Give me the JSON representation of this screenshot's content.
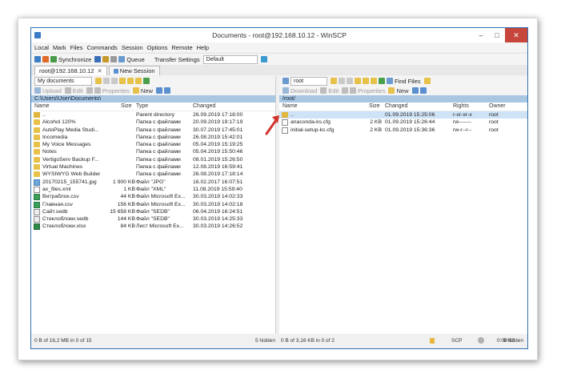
{
  "window": {
    "title": "Documents - root@192.168.10.12 - WinSCP"
  },
  "menu": [
    "Local",
    "Mark",
    "Files",
    "Commands",
    "Session",
    "Options",
    "Remote",
    "Help"
  ],
  "toolbar": {
    "synchronize": "Synchronize",
    "queue": "Queue",
    "transfer_settings_label": "Transfer Settings",
    "transfer_settings_value": "Default"
  },
  "tabs": [
    {
      "label": "root@192.168.10.12",
      "close": "✕"
    },
    {
      "label": "New Session"
    }
  ],
  "left": {
    "location": "My documents",
    "actions": {
      "upload": "Upload",
      "edit": "Edit",
      "properties": "Properties",
      "new": "New"
    },
    "path": "C:\\Users\\User\\Documents\\",
    "columns": {
      "name": "Name",
      "size": "Size",
      "type": "Type",
      "changed": "Changed"
    },
    "rows": [
      {
        "name": "..",
        "size": "",
        "type": "Parent directory",
        "changed": "26.09.2019 17:18:00",
        "kind": "up"
      },
      {
        "name": "Alcohol 120%",
        "size": "",
        "type": "Папка с файлами",
        "changed": "20.09.2019 19:17:19",
        "kind": "folder"
      },
      {
        "name": "AutoPlay Media Studi...",
        "size": "",
        "type": "Папка с файлами",
        "changed": "30.07.2019 17:45:01",
        "kind": "folder"
      },
      {
        "name": "Incomedia",
        "size": "",
        "type": "Папка с файлами",
        "changed": "26.08.2019 15:42:01",
        "kind": "folder"
      },
      {
        "name": "My Voice Messages",
        "size": "",
        "type": "Папка с файлами",
        "changed": "05.04.2019 15:19:25",
        "kind": "folder"
      },
      {
        "name": "Notes",
        "size": "",
        "type": "Папка с файлами",
        "changed": "05.04.2019 15:50:46",
        "kind": "folder"
      },
      {
        "name": "VertigoServ Backup F...",
        "size": "",
        "type": "Папка с файлами",
        "changed": "08.01.2019 15:26:50",
        "kind": "folder"
      },
      {
        "name": "Virtual Machines",
        "size": "",
        "type": "Папка с файлами",
        "changed": "12.08.2019 16:59:41",
        "kind": "folder"
      },
      {
        "name": "WYSIWYG Web Builder",
        "size": "",
        "type": "Папка с файлами",
        "changed": "26.08.2019 17:18:14",
        "kind": "folder"
      },
      {
        "name": "20170215_155741.jpg",
        "size": "1 900 KB",
        "type": "Файл \"JPG\"",
        "changed": "16.02.2017 16:07:51",
        "kind": "img"
      },
      {
        "name": "ax_files.xml",
        "size": "1 KB",
        "type": "Файл \"XML\"",
        "changed": "11.08.2019 15:59:40",
        "kind": "file"
      },
      {
        "name": "Витраблок.csv",
        "size": "44 KB",
        "type": "Файл Microsoft Ex...",
        "changed": "30.03.2019 14:02:33",
        "kind": "csv"
      },
      {
        "name": "Главная.csv",
        "size": "156 KB",
        "type": "Файл Microsoft Ex...",
        "changed": "30.03.2019 14:02:18",
        "kind": "csv"
      },
      {
        "name": "Сайт.sedb",
        "size": "15 658 KB",
        "type": "Файл \"SEDB\"",
        "changed": "06.04.2019 16:24:51",
        "kind": "sdb"
      },
      {
        "name": "Стеклоблоки.sedb",
        "size": "144 KB",
        "type": "Файл \"SEDB\"",
        "changed": "30.03.2019 14:25:33",
        "kind": "sdb"
      },
      {
        "name": "Стеклоблоки.xlsx",
        "size": "84 KB",
        "type": "Лист Microsoft Ex...",
        "changed": "30.03.2019 14:26:52",
        "kind": "xls"
      }
    ],
    "status_left": "0 B of 16,2 MB in 0 of 15",
    "status_hidden": "5 hidden"
  },
  "right": {
    "location": "root",
    "find_files": "Find Files",
    "actions": {
      "download": "Download",
      "edit": "Edit",
      "properties": "Properties",
      "new": "New"
    },
    "path": "/root/",
    "columns": {
      "name": "Name",
      "size": "Size",
      "changed": "Changed",
      "rights": "Rights",
      "owner": "Owner"
    },
    "rows": [
      {
        "name": "..",
        "size": "",
        "changed": "01.09.2019 15:25:06",
        "rights": "r-xr-xr-x",
        "owner": "root",
        "kind": "up",
        "selected": true
      },
      {
        "name": "anaconda-ks.cfg",
        "size": "2 KB",
        "changed": "01.09.2019 15:26:44",
        "rights": "rw-------",
        "owner": "root",
        "kind": "file"
      },
      {
        "name": "initial-setup-ks.cfg",
        "size": "2 KB",
        "changed": "01.09.2019 15:36:36",
        "rights": "rw-r--r--",
        "owner": "root",
        "kind": "file"
      }
    ],
    "status_left": "0 B of 3,16 KB in 0 of 2",
    "status_hidden": "9 hidden"
  },
  "status": {
    "protocol": "SCP",
    "timer": "0:00:02"
  },
  "colors": {
    "path_bar": "#a9c6e3",
    "selection": "#cfe3f7",
    "arrow": "#d0332a",
    "close": "#c7463b"
  }
}
